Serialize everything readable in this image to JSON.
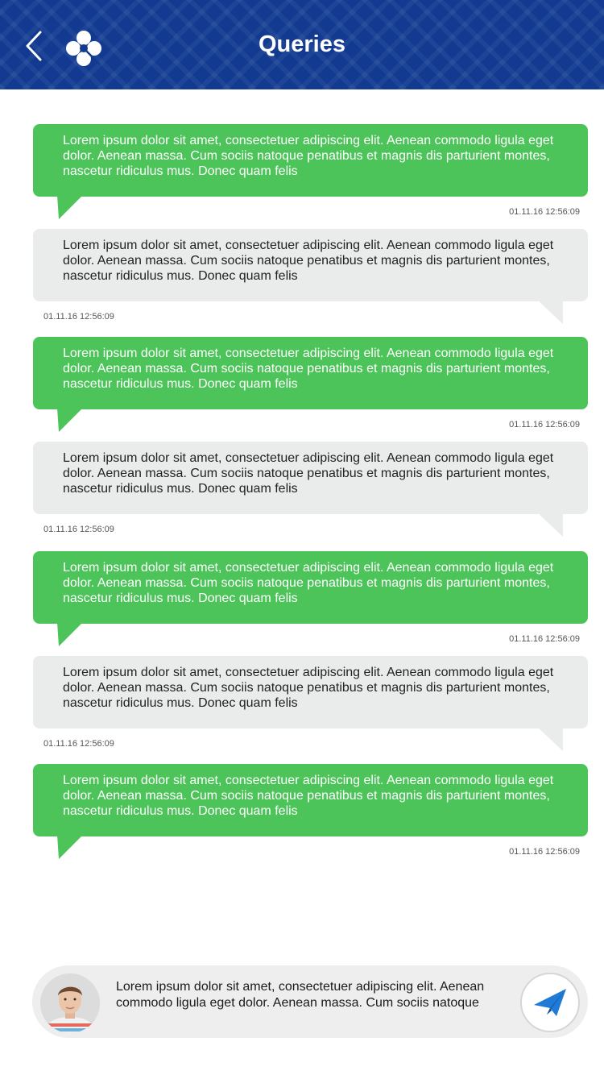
{
  "header": {
    "title": "Queries"
  },
  "icons": {
    "back": "chevron-left-icon",
    "logo": "clover-logo-icon",
    "send": "paper-plane-icon"
  },
  "colors": {
    "header_bg": "#123a91",
    "sent_bubble": "#4cc45a",
    "received_bubble": "#eaebeb",
    "send_icon": "#1f7bd6"
  },
  "messages": [
    {
      "type": "sent",
      "text": "Lorem ipsum dolor sit amet, consectetuer adipiscing elit. Aenean commodo ligula eget dolor. Aenean massa. Cum sociis natoque penatibus et magnis dis parturient montes, nascetur ridiculus mus. Donec quam felis",
      "time": "01.11.16 12:56:09"
    },
    {
      "type": "received",
      "text": "Lorem ipsum dolor sit amet, consectetuer adipiscing elit. Aenean commodo ligula eget dolor. Aenean massa. Cum sociis natoque penatibus et magnis dis parturient montes, nascetur ridiculus mus. Donec quam felis",
      "time": "01.11.16 12:56:09"
    },
    {
      "type": "sent",
      "text": "Lorem ipsum dolor sit amet, consectetuer adipiscing elit. Aenean commodo ligula eget dolor. Aenean massa. Cum sociis natoque penatibus et magnis dis parturient montes, nascetur ridiculus mus. Donec quam felis",
      "time": "01.11.16 12:56:09"
    },
    {
      "type": "received",
      "text": "Lorem ipsum dolor sit amet, consectetuer adipiscing elit. Aenean commodo ligula eget dolor. Aenean massa. Cum sociis natoque penatibus et magnis dis parturient montes, nascetur ridiculus mus. Donec quam felis",
      "time": "01.11.16 12:56:09"
    },
    {
      "type": "sent",
      "text": "Lorem ipsum dolor sit amet, consectetuer adipiscing elit. Aenean commodo ligula eget dolor. Aenean massa. Cum sociis natoque penatibus et magnis dis parturient montes, nascetur ridiculus mus. Donec quam felis",
      "time": "01.11.16 12:56:09"
    },
    {
      "type": "received",
      "text": "Lorem ipsum dolor sit amet, consectetuer adipiscing elit. Aenean commodo ligula eget dolor. Aenean massa. Cum sociis natoque penatibus et magnis dis parturient montes, nascetur ridiculus mus. Donec quam felis",
      "time": "01.11.16 12:56:09"
    },
    {
      "type": "sent",
      "text": "Lorem ipsum dolor sit amet, consectetuer adipiscing elit. Aenean commodo ligula eget dolor. Aenean massa. Cum sociis natoque penatibus et magnis dis parturient montes, nascetur ridiculus mus. Donec quam felis",
      "time": "01.11.16 12:56:09"
    }
  ],
  "composer": {
    "value": "Lorem ipsum dolor sit amet, consectetuer adipiscing elit. Aenean commodo ligula eget dolor. Aenean massa. Cum sociis natoque"
  }
}
